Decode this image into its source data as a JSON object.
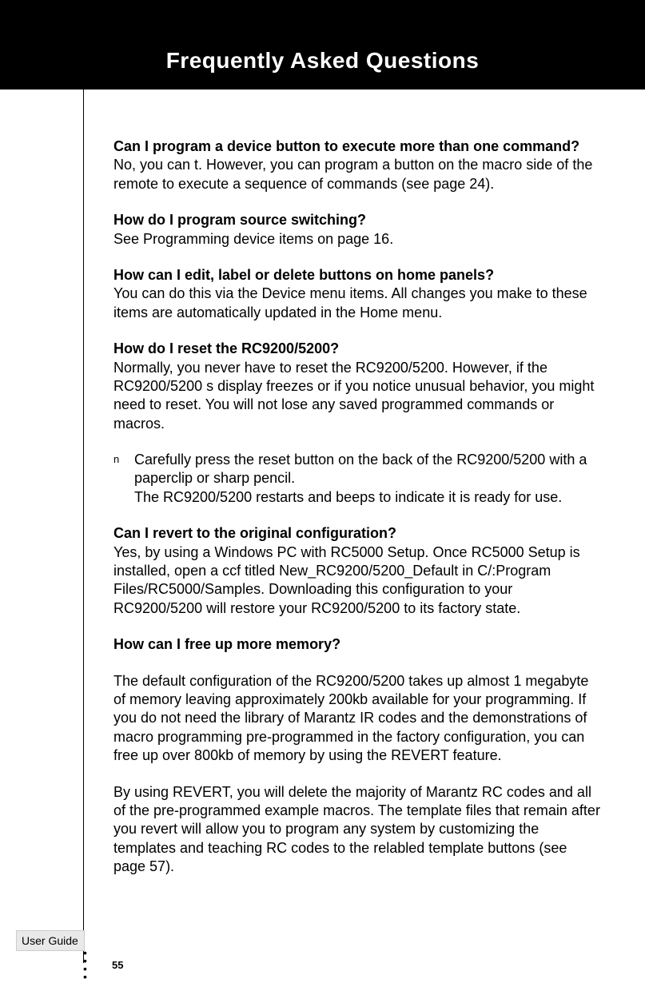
{
  "header": {
    "title": "Frequently Asked Questions"
  },
  "side": {
    "label": "User Guide"
  },
  "pagenum": "55",
  "faq": {
    "q1": "Can I program a device button to execute more than one command?",
    "a1": "No, you can t. However, you can program a button on the macro side of the remote to execute a sequence of commands (see page 24).",
    "q2": "How do I program source switching?",
    "a2": "See  Programming device items  on page 16.",
    "q3": "How can I edit, label or delete buttons on home panels?",
    "a3": "You can do this via the Device menu items. All changes you make to these items are automatically updated in the Home menu.",
    "q4": "How do I reset the RC9200/5200?",
    "a4": "Normally, you never have to reset the RC9200/5200. However, if the RC9200/5200 s display freezes or if you notice unusual behavior, you might need to reset. You will not lose any saved programmed commands or macros.",
    "bullet_mark": "n",
    "bullet": "Carefully press the reset button on the back of the RC9200/5200 with a paperclip or sharp pencil.\nThe RC9200/5200 restarts and beeps to indicate it is ready for use.",
    "q5": "Can I revert to the original configuration?",
    "a5": "Yes, by using a Windows PC with RC5000 Setup. Once RC5000 Setup is installed, open a ccf titled New_RC9200/5200_Default in C/:Program Files/RC5000/Samples. Downloading this configuration to your RC9200/5200 will restore your RC9200/5200 to its factory state.",
    "q6": "How can I free up more memory?",
    "a6p1": "The default configuration of the RC9200/5200 takes up almost 1 megabyte of memory leaving approximately 200kb available for your programming. If you do not need the library of Marantz IR codes and the demonstrations of macro programming pre-programmed in the factory configuration, you can free up over 800kb of memory by using the REVERT feature.",
    "a6p2": "By using REVERT, you will delete the majority of Marantz RC codes and all of the pre-programmed example macros. The template files that remain after you revert will allow you to program any system by customizing the templates and teaching RC codes to the relabled template buttons (see page 57)."
  }
}
